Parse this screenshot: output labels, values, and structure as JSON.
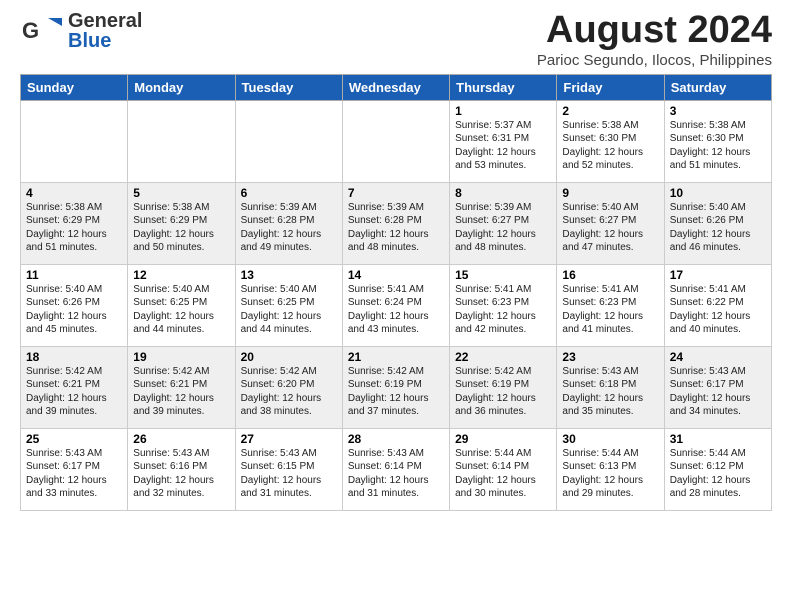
{
  "header": {
    "logo_general": "General",
    "logo_blue": "Blue",
    "title": "August 2024",
    "location": "Parioc Segundo, Ilocos, Philippines"
  },
  "calendar": {
    "days_of_week": [
      "Sunday",
      "Monday",
      "Tuesday",
      "Wednesday",
      "Thursday",
      "Friday",
      "Saturday"
    ],
    "weeks": [
      [
        {
          "day": "",
          "content": ""
        },
        {
          "day": "",
          "content": ""
        },
        {
          "day": "",
          "content": ""
        },
        {
          "day": "",
          "content": ""
        },
        {
          "day": "1",
          "content": "Sunrise: 5:37 AM\nSunset: 6:31 PM\nDaylight: 12 hours\nand 53 minutes."
        },
        {
          "day": "2",
          "content": "Sunrise: 5:38 AM\nSunset: 6:30 PM\nDaylight: 12 hours\nand 52 minutes."
        },
        {
          "day": "3",
          "content": "Sunrise: 5:38 AM\nSunset: 6:30 PM\nDaylight: 12 hours\nand 51 minutes."
        }
      ],
      [
        {
          "day": "4",
          "content": "Sunrise: 5:38 AM\nSunset: 6:29 PM\nDaylight: 12 hours\nand 51 minutes."
        },
        {
          "day": "5",
          "content": "Sunrise: 5:38 AM\nSunset: 6:29 PM\nDaylight: 12 hours\nand 50 minutes."
        },
        {
          "day": "6",
          "content": "Sunrise: 5:39 AM\nSunset: 6:28 PM\nDaylight: 12 hours\nand 49 minutes."
        },
        {
          "day": "7",
          "content": "Sunrise: 5:39 AM\nSunset: 6:28 PM\nDaylight: 12 hours\nand 48 minutes."
        },
        {
          "day": "8",
          "content": "Sunrise: 5:39 AM\nSunset: 6:27 PM\nDaylight: 12 hours\nand 48 minutes."
        },
        {
          "day": "9",
          "content": "Sunrise: 5:40 AM\nSunset: 6:27 PM\nDaylight: 12 hours\nand 47 minutes."
        },
        {
          "day": "10",
          "content": "Sunrise: 5:40 AM\nSunset: 6:26 PM\nDaylight: 12 hours\nand 46 minutes."
        }
      ],
      [
        {
          "day": "11",
          "content": "Sunrise: 5:40 AM\nSunset: 6:26 PM\nDaylight: 12 hours\nand 45 minutes."
        },
        {
          "day": "12",
          "content": "Sunrise: 5:40 AM\nSunset: 6:25 PM\nDaylight: 12 hours\nand 44 minutes."
        },
        {
          "day": "13",
          "content": "Sunrise: 5:40 AM\nSunset: 6:25 PM\nDaylight: 12 hours\nand 44 minutes."
        },
        {
          "day": "14",
          "content": "Sunrise: 5:41 AM\nSunset: 6:24 PM\nDaylight: 12 hours\nand 43 minutes."
        },
        {
          "day": "15",
          "content": "Sunrise: 5:41 AM\nSunset: 6:23 PM\nDaylight: 12 hours\nand 42 minutes."
        },
        {
          "day": "16",
          "content": "Sunrise: 5:41 AM\nSunset: 6:23 PM\nDaylight: 12 hours\nand 41 minutes."
        },
        {
          "day": "17",
          "content": "Sunrise: 5:41 AM\nSunset: 6:22 PM\nDaylight: 12 hours\nand 40 minutes."
        }
      ],
      [
        {
          "day": "18",
          "content": "Sunrise: 5:42 AM\nSunset: 6:21 PM\nDaylight: 12 hours\nand 39 minutes."
        },
        {
          "day": "19",
          "content": "Sunrise: 5:42 AM\nSunset: 6:21 PM\nDaylight: 12 hours\nand 39 minutes."
        },
        {
          "day": "20",
          "content": "Sunrise: 5:42 AM\nSunset: 6:20 PM\nDaylight: 12 hours\nand 38 minutes."
        },
        {
          "day": "21",
          "content": "Sunrise: 5:42 AM\nSunset: 6:19 PM\nDaylight: 12 hours\nand 37 minutes."
        },
        {
          "day": "22",
          "content": "Sunrise: 5:42 AM\nSunset: 6:19 PM\nDaylight: 12 hours\nand 36 minutes."
        },
        {
          "day": "23",
          "content": "Sunrise: 5:43 AM\nSunset: 6:18 PM\nDaylight: 12 hours\nand 35 minutes."
        },
        {
          "day": "24",
          "content": "Sunrise: 5:43 AM\nSunset: 6:17 PM\nDaylight: 12 hours\nand 34 minutes."
        }
      ],
      [
        {
          "day": "25",
          "content": "Sunrise: 5:43 AM\nSunset: 6:17 PM\nDaylight: 12 hours\nand 33 minutes."
        },
        {
          "day": "26",
          "content": "Sunrise: 5:43 AM\nSunset: 6:16 PM\nDaylight: 12 hours\nand 32 minutes."
        },
        {
          "day": "27",
          "content": "Sunrise: 5:43 AM\nSunset: 6:15 PM\nDaylight: 12 hours\nand 31 minutes."
        },
        {
          "day": "28",
          "content": "Sunrise: 5:43 AM\nSunset: 6:14 PM\nDaylight: 12 hours\nand 31 minutes."
        },
        {
          "day": "29",
          "content": "Sunrise: 5:44 AM\nSunset: 6:14 PM\nDaylight: 12 hours\nand 30 minutes."
        },
        {
          "day": "30",
          "content": "Sunrise: 5:44 AM\nSunset: 6:13 PM\nDaylight: 12 hours\nand 29 minutes."
        },
        {
          "day": "31",
          "content": "Sunrise: 5:44 AM\nSunset: 6:12 PM\nDaylight: 12 hours\nand 28 minutes."
        }
      ]
    ]
  }
}
